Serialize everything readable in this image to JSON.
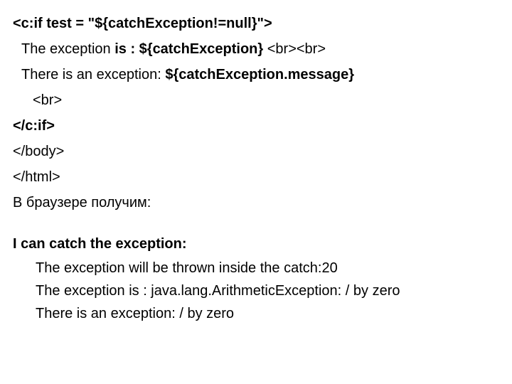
{
  "code": {
    "line1": {
      "open": "<c:if test = \"",
      "expr": "${catchException!=null}",
      "close": "\">"
    },
    "line2": {
      "t1": "The exception ",
      "t2": "is : ${catchException}",
      "t3": " <br><br>"
    },
    "line3": {
      "t1": "There is an exception: ",
      "t2": "${catchException.message}"
    },
    "line4": "<br>",
    "line5": "</c:if>",
    "line6": "</body>",
    "line7": "</html>"
  },
  "prose": {
    "browser_result": "В браузере получим:"
  },
  "output": {
    "heading": "I can catch the exception:",
    "l1": "The exception will be thrown inside the catch:20",
    "l2": "The exception is : java.lang.ArithmeticException: / by zero",
    "l3": "There is an exception: / by zero"
  }
}
